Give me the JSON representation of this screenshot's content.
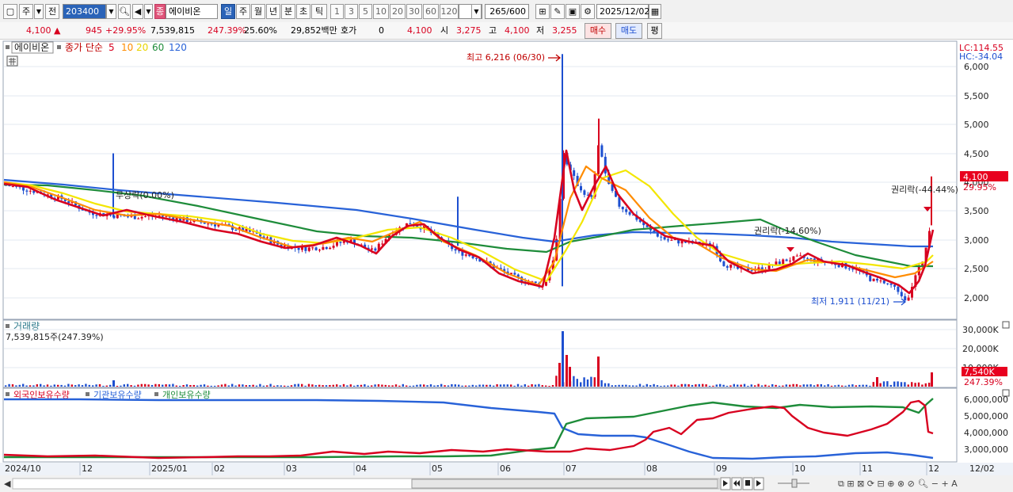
{
  "toolbar": {
    "period_main": "주",
    "prev_label": "전",
    "code": "203400",
    "stock_badge": "종",
    "stock_name": "에이비온",
    "periods": [
      "일",
      "주",
      "월",
      "년",
      "분",
      "초",
      "틱"
    ],
    "selected_period": "일",
    "intervals": [
      "1",
      "3",
      "5",
      "10",
      "20",
      "30",
      "60",
      "120"
    ],
    "count": "265",
    "count_total": "/600",
    "date": "2025/12/02"
  },
  "info": {
    "price": "4,100",
    "change": "945",
    "change_pct": "+29.95%",
    "volume": "7,539,815",
    "volume_ratio": "247.39%",
    "turnover": "25.60%",
    "amount": "29,852백만",
    "ask_label": "호가",
    "ask_value": "0",
    "ask_price": "4,100",
    "open_label": "시",
    "open": "3,275",
    "high_label": "고",
    "high": "4,100",
    "low_label": "저",
    "low": "3,255",
    "buy_label": "매수",
    "sell_label": "매도",
    "avg_label": "평"
  },
  "main_chart": {
    "legend_name": "에이비온",
    "legend_ma": "종가 단순",
    "ma_periods": [
      {
        "label": "5",
        "color": "#d8001f"
      },
      {
        "label": "10",
        "color": "#ff8c00"
      },
      {
        "label": "20",
        "color": "#e8d400"
      },
      {
        "label": "60",
        "color": "#1e8c3a"
      },
      {
        "label": "120",
        "color": "#2862d8"
      }
    ],
    "lc": "LC:114.55",
    "hc": "HC:-34.04",
    "y_ticks": [
      "6,000",
      "5,500",
      "5,000",
      "4,500",
      "4,000",
      "3,500",
      "3,000",
      "2,500",
      "2,000"
    ],
    "current_price_tag": "4,100",
    "current_pct_tag": "29.95%",
    "high_annot": "최고 6,216 (06/30)",
    "low_annot": "최저 1,911 (11/21)",
    "rights1": "권리락(-14.60%)",
    "rights2": "권리락(-44.44%)",
    "rights3": "무상락(0.00%)"
  },
  "volume_chart": {
    "title": "거래량",
    "value": "7,539,815주(247.39%)",
    "y_ticks": [
      "30,000K",
      "20,000K",
      "10,000K"
    ],
    "tag_value": "7,540K",
    "tag_pct": "247.39%"
  },
  "holdings_chart": {
    "legend": [
      "외국인보유수량",
      "기관보유수량",
      "개인보유수량"
    ],
    "legend_colors": [
      "#d8001f",
      "#2862d8",
      "#1e8c3a"
    ],
    "y_ticks": [
      "6,000,000",
      "5,000,000",
      "4,000,000",
      "3,000,000"
    ]
  },
  "x_axis": {
    "labels": [
      "2024/10",
      "12",
      "2025/01",
      "02",
      "03",
      "04",
      "05",
      "06",
      "07",
      "08",
      "09",
      "10",
      "11",
      "12"
    ],
    "end_label": "12/02"
  },
  "chart_data": {
    "type": "candlestick",
    "y_range": [
      1900,
      6300
    ],
    "months": [
      "2024/10",
      "12",
      "2025/01",
      "02",
      "03",
      "04",
      "05",
      "06",
      "07",
      "08",
      "09",
      "10",
      "11",
      "12"
    ],
    "close_series_approx": [
      {
        "x": "2024/10",
        "y": 3950
      },
      {
        "x": "2024/11",
        "y": 3600
      },
      {
        "x": "2024/12",
        "y": 3450
      },
      {
        "x": "2025/01",
        "y": 3350
      },
      {
        "x": "2025/02",
        "y": 3200
      },
      {
        "x": "2025/03",
        "y": 2900
      },
      {
        "x": "2025/04",
        "y": 3050
      },
      {
        "x": "2025/05",
        "y": 2700
      },
      {
        "x": "2025/06",
        "y": 2200
      },
      {
        "x": "2025/06/30",
        "y": 6216
      },
      {
        "x": "2025/07",
        "y": 3900
      },
      {
        "x": "2025/08",
        "y": 2950
      },
      {
        "x": "2025/09",
        "y": 2500
      },
      {
        "x": "2025/10",
        "y": 2700
      },
      {
        "x": "2025/11/21",
        "y": 1911
      },
      {
        "x": "2025/12/02",
        "y": 4100
      }
    ],
    "max": {
      "label": "최고",
      "value": 6216,
      "date": "06/30"
    },
    "min": {
      "label": "최저",
      "value": 1911,
      "date": "11/21"
    }
  }
}
